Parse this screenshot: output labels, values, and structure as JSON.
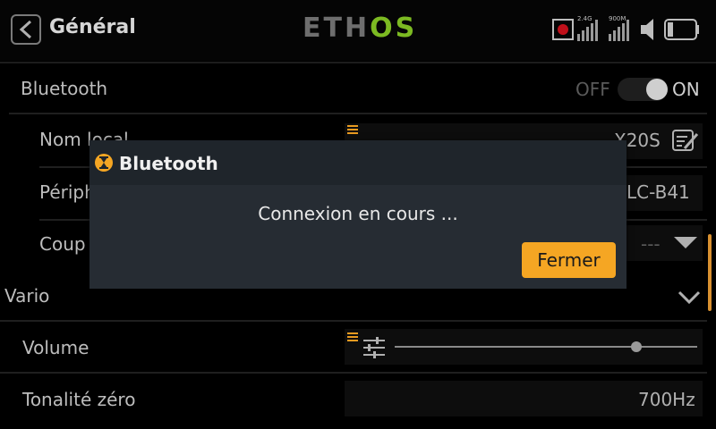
{
  "header": {
    "title": "Général",
    "logo_left": "ETH",
    "logo_right": "OS",
    "rf_band_label": "2.4G",
    "rf_900_label": "900M",
    "icons": [
      "back-chevron-icon",
      "record-icon",
      "signal-2-4g-icon",
      "signal-900m-icon",
      "speaker-icon",
      "battery-icon"
    ]
  },
  "bluetooth": {
    "label": "Bluetooth",
    "toggle_off": "OFF",
    "toggle_on": "ON",
    "toggle_state": "on"
  },
  "rows": {
    "local_name_label": "Nom local",
    "local_name_value": "X20S",
    "peripheral_label": "Périph",
    "peripheral_value": "LC-B41",
    "coup_label": "Coup",
    "coup_value": "---"
  },
  "vario": {
    "label": "Vario",
    "volume_label": "Volume",
    "volume_level": 0.8,
    "zero_tone_label": "Tonalité zéro",
    "zero_tone_value": "700Hz"
  },
  "dialog": {
    "title": "Bluetooth",
    "message": "Connexion en cours ...",
    "close_label": "Fermer"
  },
  "colors": {
    "accent": "#f5a623",
    "logo_green": "#7cba22",
    "record_red": "#c0101a"
  }
}
